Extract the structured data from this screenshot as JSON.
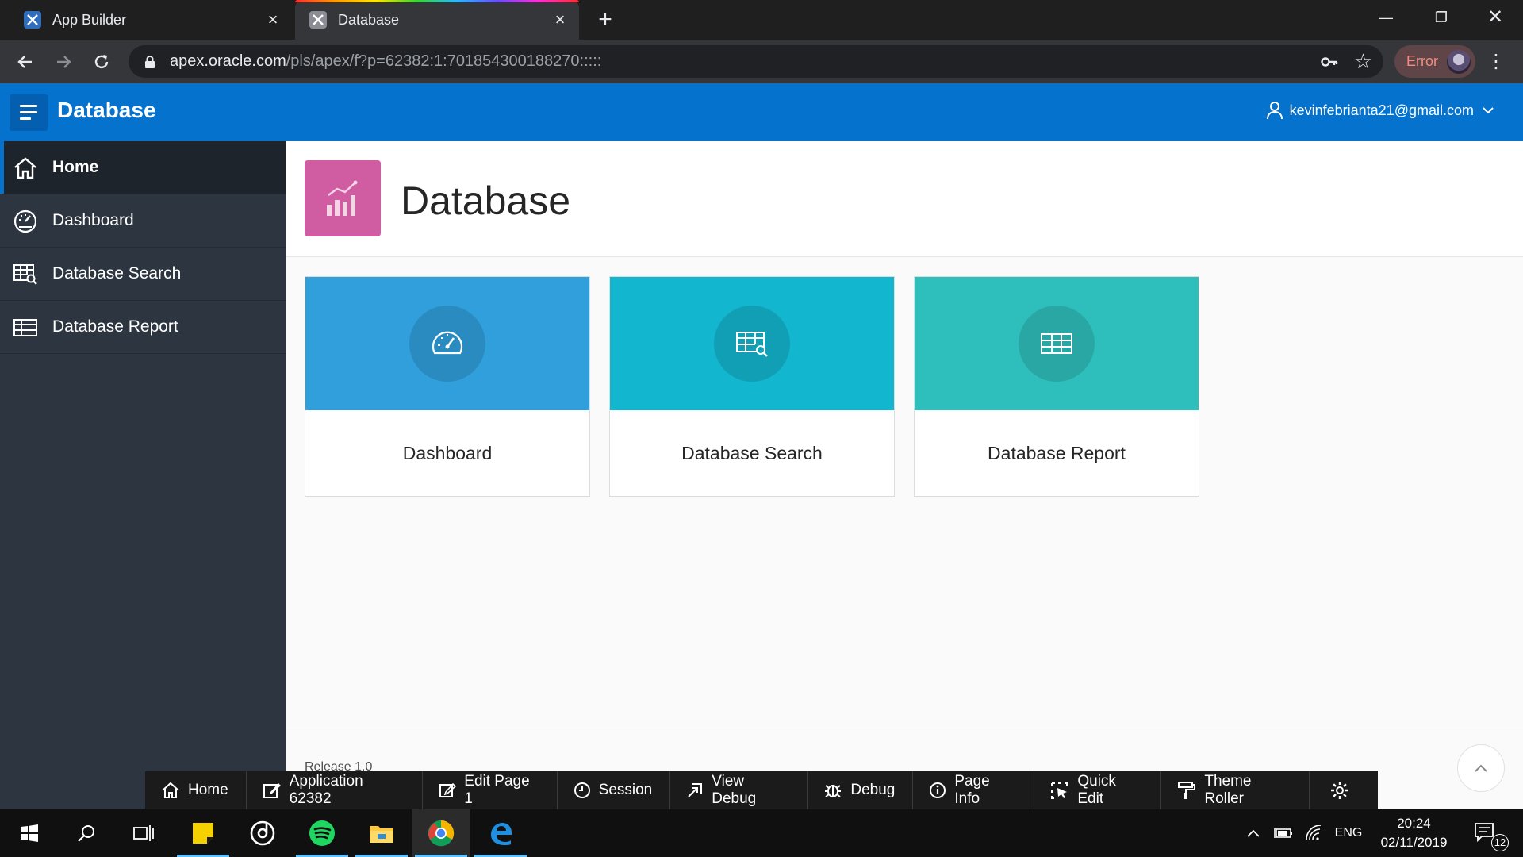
{
  "browser": {
    "tabs": [
      {
        "title": "App Builder",
        "active": false
      },
      {
        "title": "Database",
        "active": true
      }
    ],
    "url_host": "apex.oracle.com",
    "url_path": "/pls/apex/f?p=62382:1:701854300188270:::::",
    "profile_status": "Error"
  },
  "header": {
    "app_title": "Database",
    "user": "kevinfebrianta21@gmail.com"
  },
  "sidebar": {
    "items": [
      {
        "label": "Home",
        "icon": "home-icon",
        "active": true
      },
      {
        "label": "Dashboard",
        "icon": "speedometer-icon",
        "active": false
      },
      {
        "label": "Database Search",
        "icon": "table-search-icon",
        "active": false
      },
      {
        "label": "Database Report",
        "icon": "table-icon",
        "active": false
      }
    ]
  },
  "main": {
    "page_title": "Database",
    "cards": [
      {
        "label": "Dashboard",
        "icon": "speedometer-icon",
        "color": "#309fdb"
      },
      {
        "label": "Database Search",
        "icon": "table-search-icon",
        "color": "#13b6cf"
      },
      {
        "label": "Database Report",
        "icon": "table-icon",
        "color": "#2ebfbc"
      }
    ],
    "release": "Release 1.0"
  },
  "dev_toolbar": {
    "items": [
      {
        "label": "Home",
        "icon": "home-icon"
      },
      {
        "label": "Application 62382",
        "icon": "edit-icon"
      },
      {
        "label": "Edit Page 1",
        "icon": "edit-icon"
      },
      {
        "label": "Session",
        "icon": "clock-icon"
      },
      {
        "label": "View Debug",
        "icon": "view-debug-icon"
      },
      {
        "label": "Debug",
        "icon": "bug-icon"
      },
      {
        "label": "Page Info",
        "icon": "info-icon"
      },
      {
        "label": "Quick Edit",
        "icon": "cursor-select-icon"
      },
      {
        "label": "Theme Roller",
        "icon": "paint-roller-icon"
      }
    ]
  },
  "taskbar": {
    "language": "ENG",
    "time": "20:24",
    "date": "02/11/2019",
    "notifications": "12"
  }
}
